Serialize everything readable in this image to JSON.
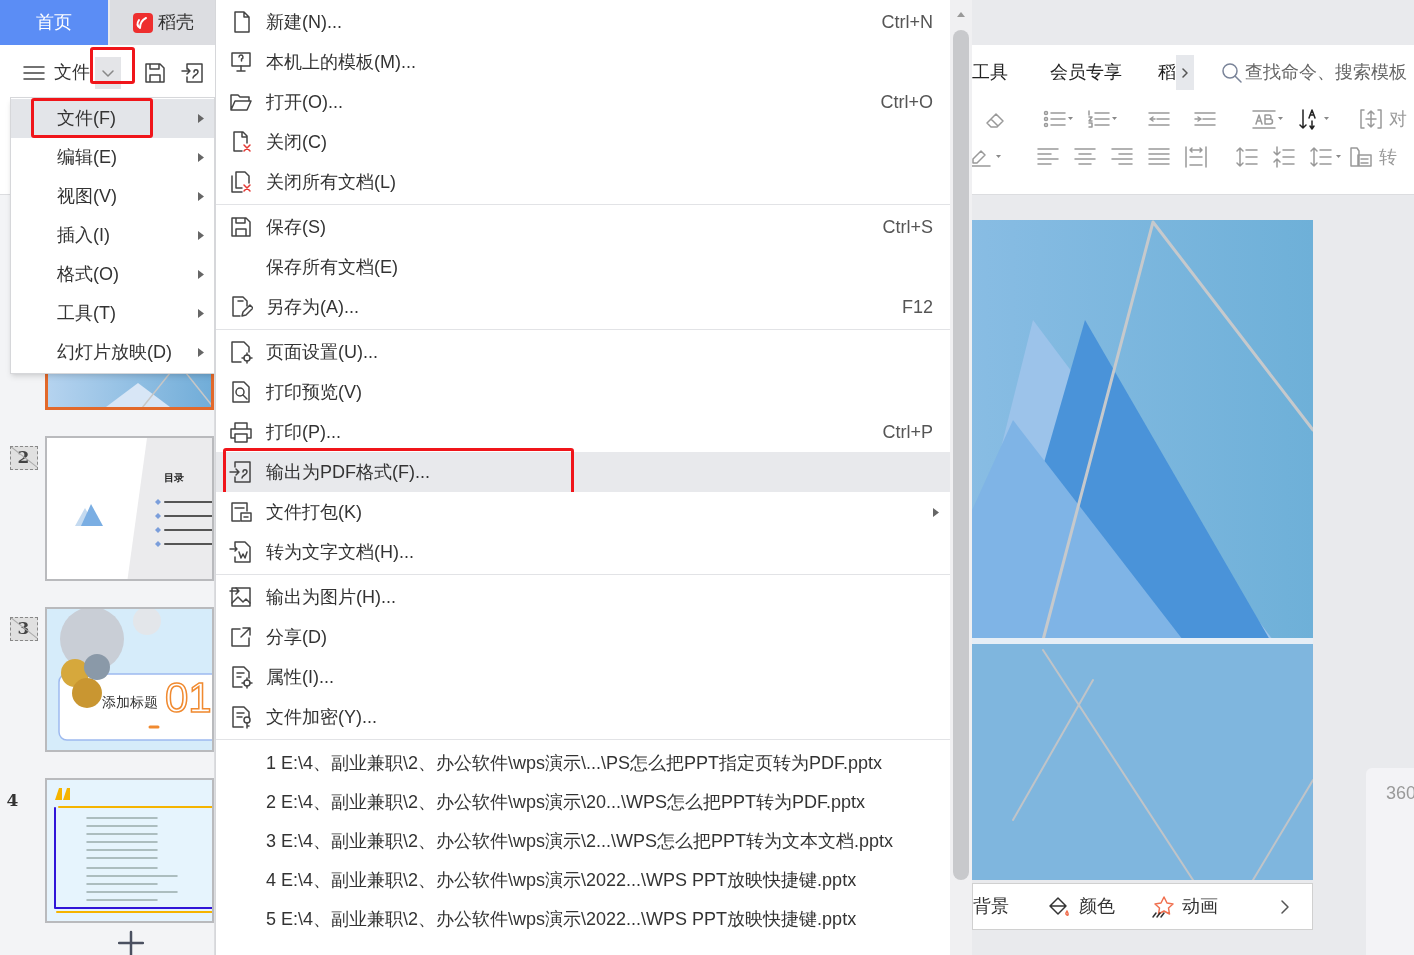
{
  "tabs": [
    {
      "label": "首页",
      "selected": true
    },
    {
      "label": "稻壳",
      "selected": false
    }
  ],
  "toolbar": {
    "file_label": "文件",
    "dropdown_highlighted": true
  },
  "ribbon_tabs": [
    {
      "label": "工具"
    },
    {
      "label": "会员专享"
    },
    {
      "label": "稻"
    }
  ],
  "search": {
    "placeholder": "查找命令、搜索模板"
  },
  "ribbon_labels": [
    "对",
    "转"
  ],
  "thumbnails": [
    {
      "kind": "cover",
      "selected": true
    },
    {
      "kind": "contents",
      "number": "2",
      "hidden": true,
      "selected": false,
      "title": "目录"
    },
    {
      "kind": "section",
      "number": "3",
      "hidden": true,
      "selected": false,
      "title": "添加标题",
      "index": "01"
    },
    {
      "kind": "text",
      "number": "4",
      "hidden": false,
      "selected": false
    }
  ],
  "menu": {
    "items": [
      {
        "label": "文件(F)",
        "selected": true,
        "highlighted": true
      },
      {
        "label": "编辑(E)",
        "selected": false,
        "highlighted": false
      },
      {
        "label": "视图(V)",
        "selected": false,
        "highlighted": false
      },
      {
        "label": "插入(I)",
        "selected": false,
        "highlighted": false
      },
      {
        "label": "格式(O)",
        "selected": false,
        "highlighted": false
      },
      {
        "label": "工具(T)",
        "selected": false,
        "highlighted": false
      },
      {
        "label": "幻灯片放映(D)",
        "selected": false,
        "highlighted": false
      }
    ]
  },
  "file_menu": {
    "groups": [
      {
        "items": [
          {
            "label": "新建(N)...",
            "shortcut": "Ctrl+N",
            "selected": false,
            "highlighted": false,
            "submenu": false
          },
          {
            "label": "本机上的模板(M)...",
            "selected": false,
            "highlighted": false,
            "submenu": false
          },
          {
            "label": "打开(O)...",
            "shortcut": "Ctrl+O",
            "selected": false,
            "highlighted": false,
            "submenu": false
          },
          {
            "label": "关闭(C)",
            "selected": false,
            "highlighted": false,
            "submenu": false
          },
          {
            "label": "关闭所有文档(L)",
            "selected": false,
            "highlighted": false,
            "submenu": false
          }
        ]
      },
      {
        "items": [
          {
            "label": "保存(S)",
            "shortcut": "Ctrl+S",
            "selected": false,
            "highlighted": false,
            "submenu": false
          },
          {
            "label": "保存所有文档(E)",
            "selected": false,
            "highlighted": false,
            "submenu": false
          },
          {
            "label": "另存为(A)...",
            "shortcut": "F12",
            "selected": false,
            "highlighted": false,
            "submenu": false
          }
        ]
      },
      {
        "items": [
          {
            "label": "页面设置(U)...",
            "selected": false,
            "highlighted": false,
            "submenu": false
          },
          {
            "label": "打印预览(V)",
            "selected": false,
            "highlighted": false,
            "submenu": false
          },
          {
            "label": "打印(P)...",
            "shortcut": "Ctrl+P",
            "selected": false,
            "highlighted": false,
            "submenu": false
          },
          {
            "label": "输出为PDF格式(F)...",
            "selected": true,
            "highlighted": true,
            "submenu": false
          },
          {
            "label": "文件打包(K)",
            "selected": false,
            "highlighted": false,
            "submenu": true
          },
          {
            "label": "转为文字文档(H)...",
            "selected": false,
            "highlighted": false,
            "submenu": false
          }
        ]
      },
      {
        "items": [
          {
            "label": "输出为图片(H)...",
            "selected": false,
            "highlighted": false,
            "submenu": false
          },
          {
            "label": "分享(D)",
            "selected": false,
            "highlighted": false,
            "submenu": false
          },
          {
            "label": "属性(I)...",
            "selected": false,
            "highlighted": false,
            "submenu": false
          },
          {
            "label": "文件加密(Y)...",
            "selected": false,
            "highlighted": false,
            "submenu": false
          }
        ]
      }
    ],
    "recent": [
      "1 E:\\4、副业兼职\\2、办公软件\\wps演示\\...\\PS怎么把PPT指定页转为PDF.pptx",
      "2 E:\\4、副业兼职\\2、办公软件\\wps演示\\20...\\WPS怎么把PPT转为PDF.pptx",
      "3 E:\\4、副业兼职\\2、办公软件\\wps演示\\2...\\WPS怎么把PPT转为文本文档.pptx",
      "4 E:\\4、副业兼职\\2、办公软件\\wps演示\\2022...\\WPS PPT放映快捷键.pptx",
      "5 E:\\4、副业兼职\\2、办公软件\\wps演示\\2022...\\WPS PPT放映快捷键.pptx"
    ]
  },
  "bottom_bar": {
    "items": [
      {
        "label": "背景"
      },
      {
        "label": "颜色"
      },
      {
        "label": "动画"
      }
    ]
  },
  "side_panel": {
    "text": "360"
  }
}
